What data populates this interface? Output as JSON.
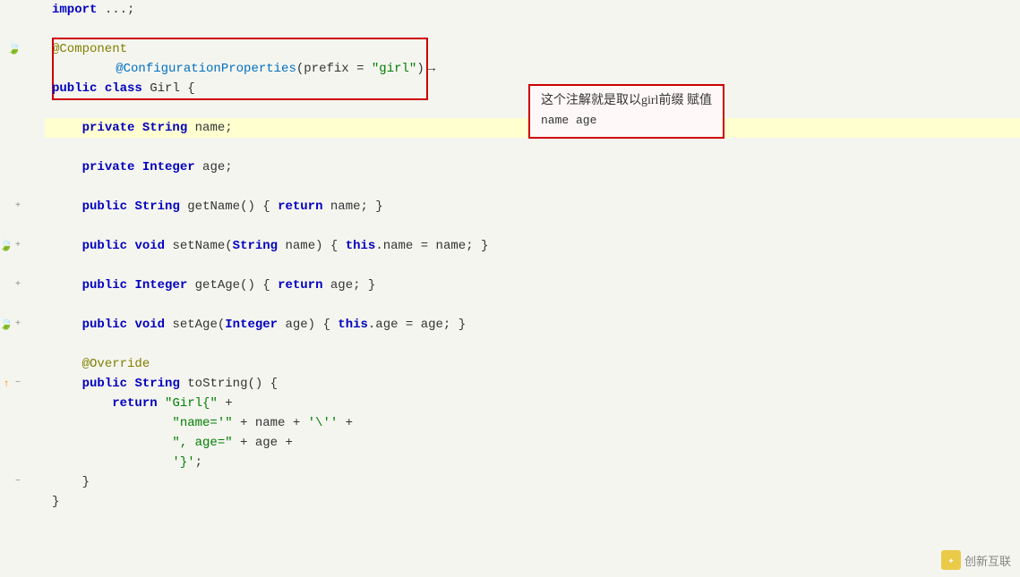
{
  "editor": {
    "lines": [
      {
        "num": "",
        "indent": 0,
        "content": "import ...;",
        "type": "comment",
        "highlight": false
      },
      {
        "num": "",
        "indent": 0,
        "content": "",
        "type": "blank",
        "highlight": false
      },
      {
        "num": "",
        "indent": 0,
        "content": "@Component",
        "type": "annotation",
        "highlight": false
      },
      {
        "num": "",
        "indent": 0,
        "content": "@ConfigurationProperties(prefix = \"girl\")",
        "type": "annotation-special",
        "highlight": false
      },
      {
        "num": "",
        "indent": 0,
        "content": "public class Girl {",
        "type": "code",
        "highlight": false
      },
      {
        "num": "",
        "indent": 0,
        "content": "",
        "type": "blank",
        "highlight": false
      },
      {
        "num": "",
        "indent": 4,
        "content": "private String name;",
        "type": "code",
        "highlight": true
      },
      {
        "num": "",
        "indent": 0,
        "content": "",
        "type": "blank",
        "highlight": false
      },
      {
        "num": "",
        "indent": 4,
        "content": "private Integer age;",
        "type": "code",
        "highlight": false
      },
      {
        "num": "",
        "indent": 0,
        "content": "",
        "type": "blank",
        "highlight": false
      },
      {
        "num": "",
        "indent": 4,
        "content": "public String getName() { return name; }",
        "type": "code",
        "highlight": false
      },
      {
        "num": "",
        "indent": 0,
        "content": "",
        "type": "blank",
        "highlight": false
      },
      {
        "num": "",
        "indent": 4,
        "content": "public void setName(String name) { this.name = name; }",
        "type": "code",
        "highlight": false
      },
      {
        "num": "",
        "indent": 0,
        "content": "",
        "type": "blank",
        "highlight": false
      },
      {
        "num": "",
        "indent": 4,
        "content": "public Integer getAge() { return age; }",
        "type": "code",
        "highlight": false
      },
      {
        "num": "",
        "indent": 0,
        "content": "",
        "type": "blank",
        "highlight": false
      },
      {
        "num": "",
        "indent": 4,
        "content": "public void setAge(Integer age) { this.age = age; }",
        "type": "code",
        "highlight": false
      },
      {
        "num": "",
        "indent": 0,
        "content": "",
        "type": "blank",
        "highlight": false
      },
      {
        "num": "",
        "indent": 4,
        "content": "@Override",
        "type": "annotation",
        "highlight": false
      },
      {
        "num": "",
        "indent": 4,
        "content": "public String toString() {",
        "type": "code",
        "highlight": false
      },
      {
        "num": "",
        "indent": 8,
        "content": "return \"Girl{\" +",
        "type": "code",
        "highlight": false
      },
      {
        "num": "",
        "indent": 12,
        "content": "\"name='\" + name + \"\\'\" +",
        "type": "code",
        "highlight": false
      },
      {
        "num": "",
        "indent": 12,
        "content": "\", age=\" + age +",
        "type": "code",
        "highlight": false
      },
      {
        "num": "",
        "indent": 12,
        "content": "\"'}';\";",
        "type": "code",
        "highlight": false
      },
      {
        "num": "",
        "indent": 4,
        "content": "}",
        "type": "code",
        "highlight": false
      },
      {
        "num": "",
        "indent": 0,
        "content": "}",
        "type": "code",
        "highlight": false
      }
    ],
    "tooltip": {
      "line1": "这个注解就是取以girl前缀 赋值",
      "line2": "name age"
    }
  },
  "watermark": {
    "text": "创新互联"
  }
}
